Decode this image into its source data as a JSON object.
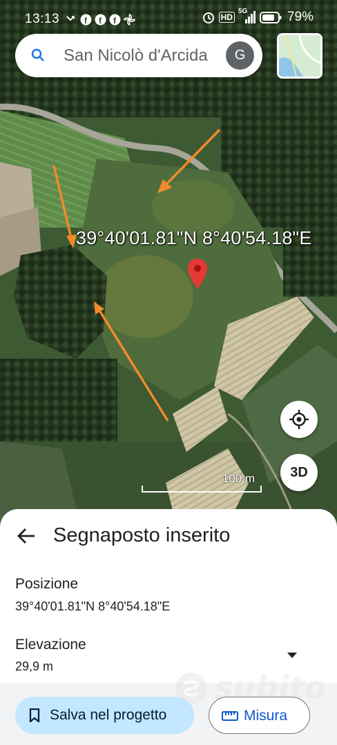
{
  "status_bar": {
    "time": "13:13",
    "battery": "79%",
    "network": "5G",
    "hd": "HD"
  },
  "search": {
    "query": "San Nicolò d'Arcida",
    "account_initial": "G"
  },
  "map": {
    "coordinate_label": "39°40'01.81\"N 8°40'54.18\"E",
    "scale_label": "100 m",
    "button_3d": "3D",
    "arrow_color": "#f28a2c",
    "pin_color": "#e53935"
  },
  "sheet": {
    "title": "Segnaposto inserito",
    "position_label": "Posizione",
    "position_value": "39°40'01.81\"N 8°40'54.18\"E",
    "elevation_label": "Elevazione",
    "elevation_value": "29,9 m"
  },
  "actions": {
    "save_label": "Salva nel progetto",
    "measure_label": "Misura"
  },
  "watermark": {
    "text": "subito"
  }
}
